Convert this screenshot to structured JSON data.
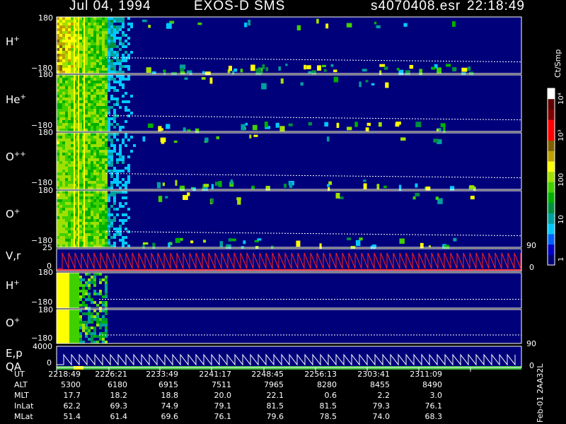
{
  "header": {
    "date": "Jul 04, 1994",
    "instrument": "EXOS-D SMS",
    "file": "s4070408.esr",
    "time": "22:18:49"
  },
  "colorbar": {
    "unit_label": "Ct/Smp",
    "ticks": [
      "1",
      "10",
      "100",
      "10³",
      "10⁴"
    ],
    "colors": [
      "#00007a",
      "#0000c8",
      "#0060ff",
      "#00c8ff",
      "#00a0a0",
      "#009040",
      "#00b000",
      "#40d000",
      "#a0e000",
      "#ffff00",
      "#c0a000",
      "#806000",
      "#ff0000",
      "#ff0000",
      "#800000",
      "#600000",
      "#ffffff"
    ]
  },
  "panels": [
    {
      "label": "H",
      "sup": "+",
      "ytop": "180",
      "ybot": "−180"
    },
    {
      "label": "He",
      "sup": "+",
      "ytop": "180",
      "ybot": "−180"
    },
    {
      "label": "O",
      "sup": "++",
      "ytop": "180",
      "ybot": "−180"
    },
    {
      "label": "O",
      "sup": "+",
      "ytop": "180",
      "ybot": "−180",
      "right_tick": "90"
    },
    {
      "label": "V,r",
      "sup": "",
      "ytop": "25",
      "ybot": "0",
      "right_tick": "0"
    },
    {
      "label": "H",
      "sup": "+",
      "ytop": "180",
      "ybot": "−180"
    },
    {
      "label": "O",
      "sup": "+",
      "ytop": "180",
      "ybot": "−180",
      "right_tick": "90"
    },
    {
      "label": "E,p",
      "sup": "",
      "ytop": "4000",
      "ybot": "0",
      "right_tick": "0"
    }
  ],
  "qa_label": "QA",
  "ephemeris": {
    "rows": [
      {
        "label": "UT",
        "values": [
          "2218:49",
          "2226:21",
          "2233:49",
          "2241:17",
          "2248:45",
          "2256:13",
          "2303:41",
          "2311:09"
        ]
      },
      {
        "label": "ALT",
        "values": [
          "5300",
          "6180",
          "6915",
          "7511",
          "7965",
          "8280",
          "8455",
          "8490"
        ]
      },
      {
        "label": "MLT",
        "values": [
          "17.7",
          "18.2",
          "18.8",
          "20.0",
          "22.1",
          "0.6",
          "2.2",
          "3.0"
        ]
      },
      {
        "label": "InLat",
        "values": [
          "62.2",
          "69.3",
          "74.9",
          "79.1",
          "81.5",
          "81.5",
          "79.3",
          "76.1"
        ]
      },
      {
        "label": "MLat",
        "values": [
          "51.4",
          "61.4",
          "69.6",
          "76.1",
          "79.6",
          "78.5",
          "74.0",
          "68.3"
        ]
      }
    ]
  },
  "footer_id": "Feb-01 2AA32L",
  "chart_data": [
    {
      "type": "heatmap",
      "title": "Jul 04, 1994 EXOS-D SMS s4070408.esr 22:18:49",
      "panels": [
        "H+",
        "He+",
        "O++",
        "O+",
        "V,r",
        "H+",
        "O+",
        "E,p"
      ],
      "ylim_pitch": [
        -180,
        180
      ],
      "ylim_v": [
        0,
        25
      ],
      "ylim_e": [
        0,
        4000
      ],
      "colorbar_range": [
        1,
        10000
      ],
      "colorbar_scale": "log",
      "x_ticks": [
        "2218:49",
        "2226:21",
        "2233:49",
        "2241:17",
        "2248:45",
        "2256:13",
        "2303:41",
        "2311:09"
      ]
    }
  ]
}
